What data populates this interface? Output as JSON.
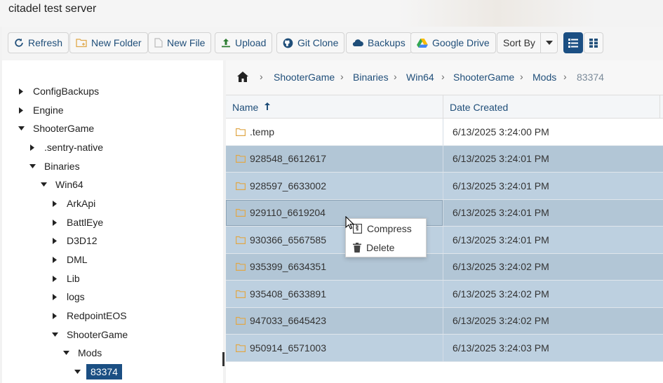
{
  "window": {
    "title": "citadel test server"
  },
  "toolbar": {
    "refresh": "Refresh",
    "new_folder": "New Folder",
    "new_file": "New File",
    "upload": "Upload",
    "git_clone": "Git Clone",
    "backups": "Backups",
    "google_drive": "Google Drive",
    "sort_by": "Sort By"
  },
  "tree": [
    {
      "label": "ConfigBackups",
      "expanded": false
    },
    {
      "label": "Engine",
      "expanded": false
    },
    {
      "label": "ShooterGame",
      "expanded": true
    },
    {
      "label": ".sentry-native",
      "expanded": false
    },
    {
      "label": "Binaries",
      "expanded": true
    },
    {
      "label": "Win64",
      "expanded": true
    },
    {
      "label": "ArkApi",
      "expanded": false
    },
    {
      "label": "BattlEye",
      "expanded": false
    },
    {
      "label": "D3D12",
      "expanded": false
    },
    {
      "label": "DML",
      "expanded": false
    },
    {
      "label": "Lib",
      "expanded": false
    },
    {
      "label": "logs",
      "expanded": false
    },
    {
      "label": "RedpointEOS",
      "expanded": false
    },
    {
      "label": "ShooterGame",
      "expanded": true
    },
    {
      "label": "Mods",
      "expanded": true
    },
    {
      "label": "83374",
      "expanded": true,
      "selected": true
    }
  ],
  "breadcrumb": [
    "ShooterGame",
    "Binaries",
    "Win64",
    "ShooterGame",
    "Mods",
    "83374"
  ],
  "grid": {
    "columns": {
      "name": "Name",
      "date": "Date Created"
    },
    "rows": [
      {
        "name": ".temp",
        "date": "6/13/2025 3:24:00 PM",
        "selected": false
      },
      {
        "name": "928548_6612617",
        "date": "6/13/2025 3:24:01 PM",
        "selected": true
      },
      {
        "name": "928597_6633002",
        "date": "6/13/2025 3:24:01 PM",
        "selected": true
      },
      {
        "name": "929110_6619204",
        "date": "6/13/2025 3:24:01 PM",
        "selected": true,
        "focused": true
      },
      {
        "name": "930366_6567585",
        "date": "6/13/2025 3:24:01 PM",
        "selected": true
      },
      {
        "name": "935399_6634351",
        "date": "6/13/2025 3:24:02 PM",
        "selected": true
      },
      {
        "name": "935408_6633891",
        "date": "6/13/2025 3:24:02 PM",
        "selected": true
      },
      {
        "name": "947033_6645423",
        "date": "6/13/2025 3:24:02 PM",
        "selected": true
      },
      {
        "name": "950914_6571003",
        "date": "6/13/2025 3:24:03 PM",
        "selected": true
      }
    ]
  },
  "context_menu": {
    "compress": "Compress",
    "delete": "Delete"
  },
  "colors": {
    "accent": "#1b4f83",
    "link": "#1f4e79",
    "folder": "#e0a84a",
    "selected_row": "#b2c6d6"
  }
}
